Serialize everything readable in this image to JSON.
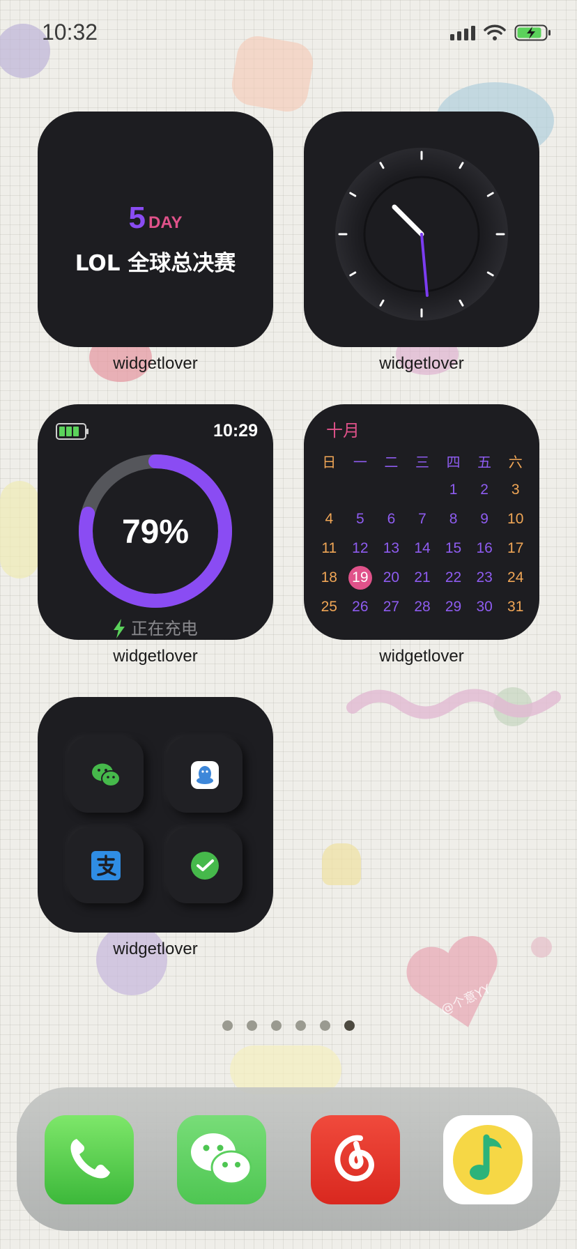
{
  "status_bar": {
    "time": "10:32"
  },
  "widgets": {
    "countdown": {
      "number": "5",
      "unit": "DAY",
      "title": "LOL 全球总决赛",
      "label": "widgetlover"
    },
    "clock": {
      "label": "widgetlover"
    },
    "battery": {
      "time": "10:29",
      "percent_text": "79%",
      "percent": 79,
      "charging_text": "正在充电",
      "label": "widgetlover"
    },
    "calendar": {
      "month": "十月",
      "weekdays": [
        "日",
        "一",
        "二",
        "三",
        "四",
        "五",
        "六"
      ],
      "days": [
        "",
        "",
        "",
        "",
        "1",
        "2",
        "3",
        "4",
        "5",
        "6",
        "7",
        "8",
        "9",
        "10",
        "11",
        "12",
        "13",
        "14",
        "15",
        "16",
        "17",
        "18",
        "19",
        "20",
        "21",
        "22",
        "23",
        "24",
        "25",
        "26",
        "27",
        "28",
        "29",
        "30",
        "31"
      ],
      "today": "19",
      "label": "widgetlover"
    },
    "apps": {
      "items": [
        "wechat-icon",
        "qq-icon",
        "alipay-icon",
        "wechat-pay-icon"
      ],
      "label": "widgetlover"
    }
  },
  "page_indicator": {
    "count": 6,
    "active": 6
  },
  "dock": {
    "apps": [
      "phone-icon",
      "wechat-icon",
      "netease-music-icon",
      "qq-music-icon"
    ]
  },
  "watermark": "@个意YY",
  "colors": {
    "accent_purple": "#8a4cf3",
    "accent_pink": "#e0528a",
    "accent_orange": "#f0a656",
    "widget_bg": "#1d1d21"
  }
}
